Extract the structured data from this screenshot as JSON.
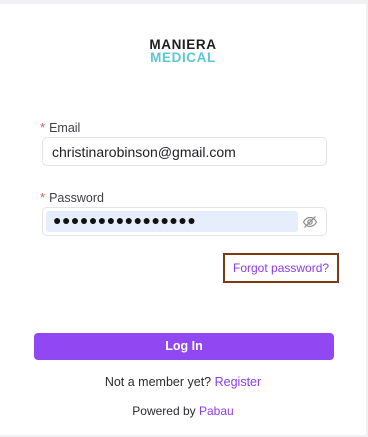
{
  "logo": {
    "line1": "MANIERA",
    "line2": "MEDICAL"
  },
  "form": {
    "email": {
      "required_mark": "*",
      "label": "Email",
      "value": "christinarobinson@gmail.com"
    },
    "password": {
      "required_mark": "*",
      "label": "Password",
      "value": "●●●●●●●●●●●●●●●●",
      "toggle_icon": "eye-off-icon"
    },
    "forgot_label": "Forgot password?",
    "login_label": "Log In"
  },
  "footer": {
    "member_text": "Not a member yet?",
    "register_label": "Register",
    "powered_text": "Powered by",
    "powered_link": "Pabau"
  },
  "colors": {
    "accent": "#9147f2",
    "link": "#8b3cf0",
    "logo_teal": "#5cc8d3",
    "required": "#e45a5a",
    "highlight_border": "#7a3a13"
  }
}
